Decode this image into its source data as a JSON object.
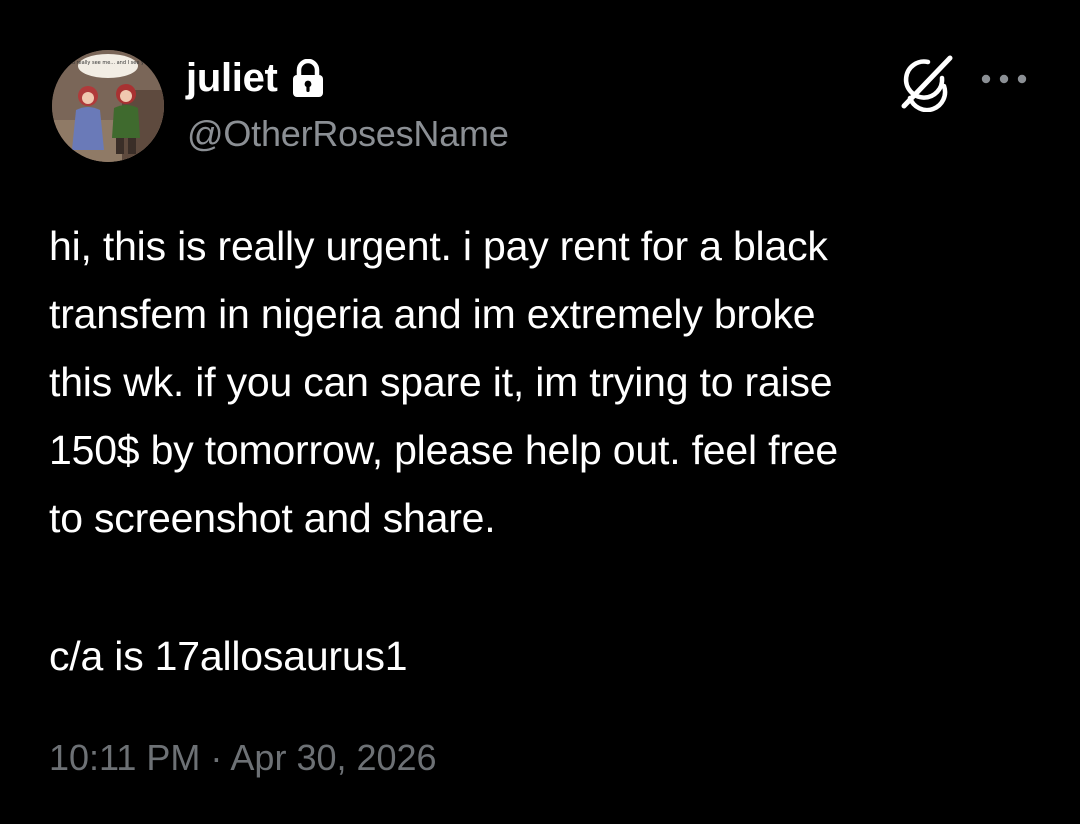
{
  "author": {
    "display_name": "juliet",
    "handle": "@OtherRosesName",
    "avatar_caption": "you really see me... and I see you"
  },
  "post": {
    "lines": [
      "hi, this is really urgent. i pay rent for a black",
      "transfem in nigeria and im extremely broke",
      "this wk. if you can spare it, im trying to raise",
      "150$ by tomorrow, please help out. feel free",
      "to screenshot and share."
    ],
    "footer_line": "c/a is 17allosaurus1"
  },
  "meta": {
    "timestamp": "10:11 PM · Apr 30, 2026"
  },
  "icons": {
    "lock": "lock-icon",
    "grok": "grok-icon",
    "more": "more-options-icon"
  },
  "colors": {
    "background": "#000000",
    "text_primary": "#ffffff",
    "text_secondary": "#8b8f94"
  }
}
